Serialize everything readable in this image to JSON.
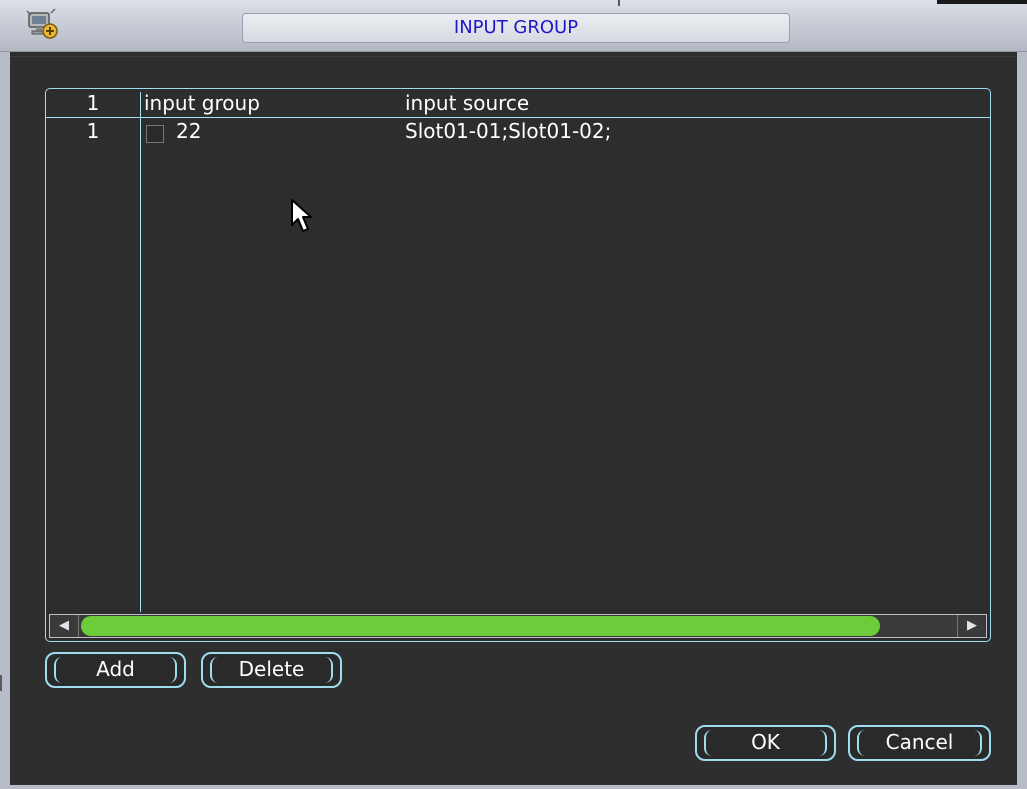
{
  "window": {
    "title": "INPUT GROUP",
    "icon": "network-settings-icon"
  },
  "table": {
    "headers": {
      "index": "1",
      "group": "input group",
      "source": "input source"
    },
    "rows": [
      {
        "index": "1",
        "checked": false,
        "group": "22",
        "source": "Slot01-01;Slot01-02;"
      }
    ]
  },
  "scrollbar": {
    "left_arrow": "◀",
    "right_arrow": "▶"
  },
  "buttons": {
    "add": "Add",
    "delete": "Delete",
    "ok": "OK",
    "cancel": "Cancel"
  },
  "colors": {
    "accent": "#9fdcf0",
    "title_text": "#1e18c8",
    "scroll_thumb": "#6ccc3a"
  }
}
